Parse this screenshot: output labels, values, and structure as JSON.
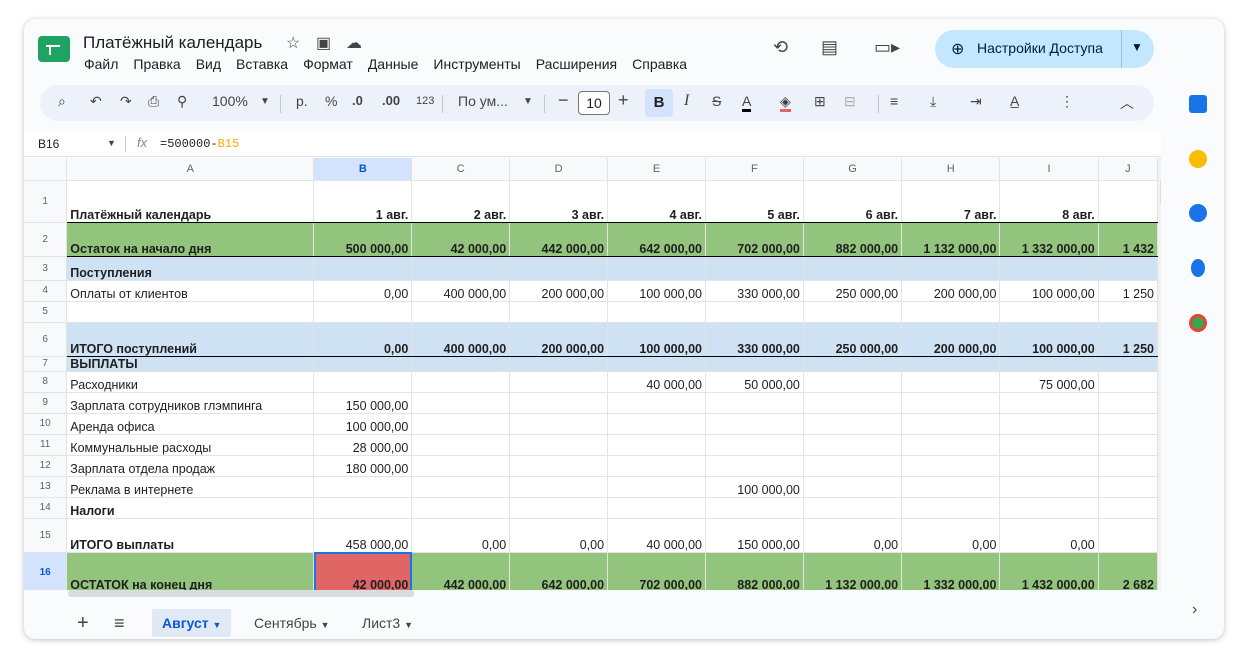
{
  "doc": {
    "title": "Платёжный календарь"
  },
  "menu": [
    "Файл",
    "Правка",
    "Вид",
    "Вставка",
    "Формат",
    "Данные",
    "Инструменты",
    "Расширения",
    "Справка"
  ],
  "header": {
    "share_label": "Настройки Доступа"
  },
  "toolbar": {
    "zoom": "100%",
    "currency": "р.",
    "percent": "%",
    "dec_less": ".0",
    "dec_more": ".00",
    "number_format": "123",
    "font": "По ум...",
    "font_size": "10",
    "bold": "B",
    "italic": "I",
    "strike": "S",
    "text_color": "A"
  },
  "formula_bar": {
    "cell_ref": "B16",
    "fx": "fx",
    "formula_prefix": "=500000-",
    "formula_ref": "B15"
  },
  "columns": [
    "A",
    "B",
    "C",
    "D",
    "E",
    "F",
    "G",
    "H",
    "I",
    "J"
  ],
  "rows": [
    {
      "n": "1",
      "cells": [
        "Платёжный календарь",
        "1 авг.",
        "2 авг.",
        "3 авг.",
        "4 авг.",
        "5 авг.",
        "6 авг.",
        "7 авг.",
        "8 авг.",
        ""
      ]
    },
    {
      "n": "2",
      "cells": [
        "Остаток на начало дня",
        "500 000,00",
        "42 000,00",
        "442 000,00",
        "642 000,00",
        "702 000,00",
        "882 000,00",
        "1 132 000,00",
        "1 332 000,00",
        "1 432"
      ]
    },
    {
      "n": "3",
      "cells": [
        "Поступления",
        "",
        "",
        "",
        "",
        "",
        "",
        "",
        "",
        ""
      ]
    },
    {
      "n": "4",
      "cells": [
        "Оплаты от клиентов",
        "0,00",
        "400 000,00",
        "200 000,00",
        "100 000,00",
        "330 000,00",
        "250 000,00",
        "200 000,00",
        "100 000,00",
        "1 250"
      ]
    },
    {
      "n": "5",
      "cells": [
        "",
        "",
        "",
        "",
        "",
        "",
        "",
        "",
        "",
        ""
      ]
    },
    {
      "n": "6",
      "cells": [
        "ИТОГО поступлений",
        "0,00",
        "400 000,00",
        "200 000,00",
        "100 000,00",
        "330 000,00",
        "250 000,00",
        "200 000,00",
        "100 000,00",
        "1 250"
      ]
    },
    {
      "n": "7",
      "cells": [
        "ВЫПЛАТЫ",
        "",
        "",
        "",
        "",
        "",
        "",
        "",
        "",
        ""
      ]
    },
    {
      "n": "8",
      "cells": [
        "Расходники",
        "",
        "",
        "",
        "40 000,00",
        "50 000,00",
        "",
        "",
        "75 000,00",
        ""
      ]
    },
    {
      "n": "9",
      "cells": [
        "Зарплата сотрудников глэмпинга",
        "150 000,00",
        "",
        "",
        "",
        "",
        "",
        "",
        "",
        ""
      ]
    },
    {
      "n": "10",
      "cells": [
        "Аренда офиса",
        "100 000,00",
        "",
        "",
        "",
        "",
        "",
        "",
        "",
        ""
      ]
    },
    {
      "n": "11",
      "cells": [
        "Коммунальные расходы",
        "28 000,00",
        "",
        "",
        "",
        "",
        "",
        "",
        "",
        ""
      ]
    },
    {
      "n": "12",
      "cells": [
        "Зарплата отдела продаж",
        "180 000,00",
        "",
        "",
        "",
        "",
        "",
        "",
        "",
        ""
      ]
    },
    {
      "n": "13",
      "cells": [
        "Реклама в интернете",
        "",
        "",
        "",
        "",
        "100 000,00",
        "",
        "",
        "",
        ""
      ]
    },
    {
      "n": "14",
      "cells": [
        "Налоги",
        "",
        "",
        "",
        "",
        "",
        "",
        "",
        "",
        ""
      ]
    },
    {
      "n": "15",
      "cells": [
        "ИТОГО выплаты",
        "458 000,00",
        "0,00",
        "0,00",
        "40 000,00",
        "150 000,00",
        "0,00",
        "0,00",
        "0,00",
        ""
      ]
    },
    {
      "n": "16",
      "cells": [
        "ОСТАТОК на конец дня",
        "42 000,00",
        "442 000,00",
        "642 000,00",
        "702 000,00",
        "882 000,00",
        "1 132 000,00",
        "1 332 000,00",
        "1 432 000,00",
        "2 682"
      ]
    }
  ],
  "sheet_tabs": [
    "Август",
    "Сентябрь",
    "Лист3"
  ],
  "colors": {
    "green_row": "#93c47d",
    "blue_row": "#cfe2f3",
    "selected_cell": "#e06666",
    "share_bg": "#c2e7ff"
  }
}
